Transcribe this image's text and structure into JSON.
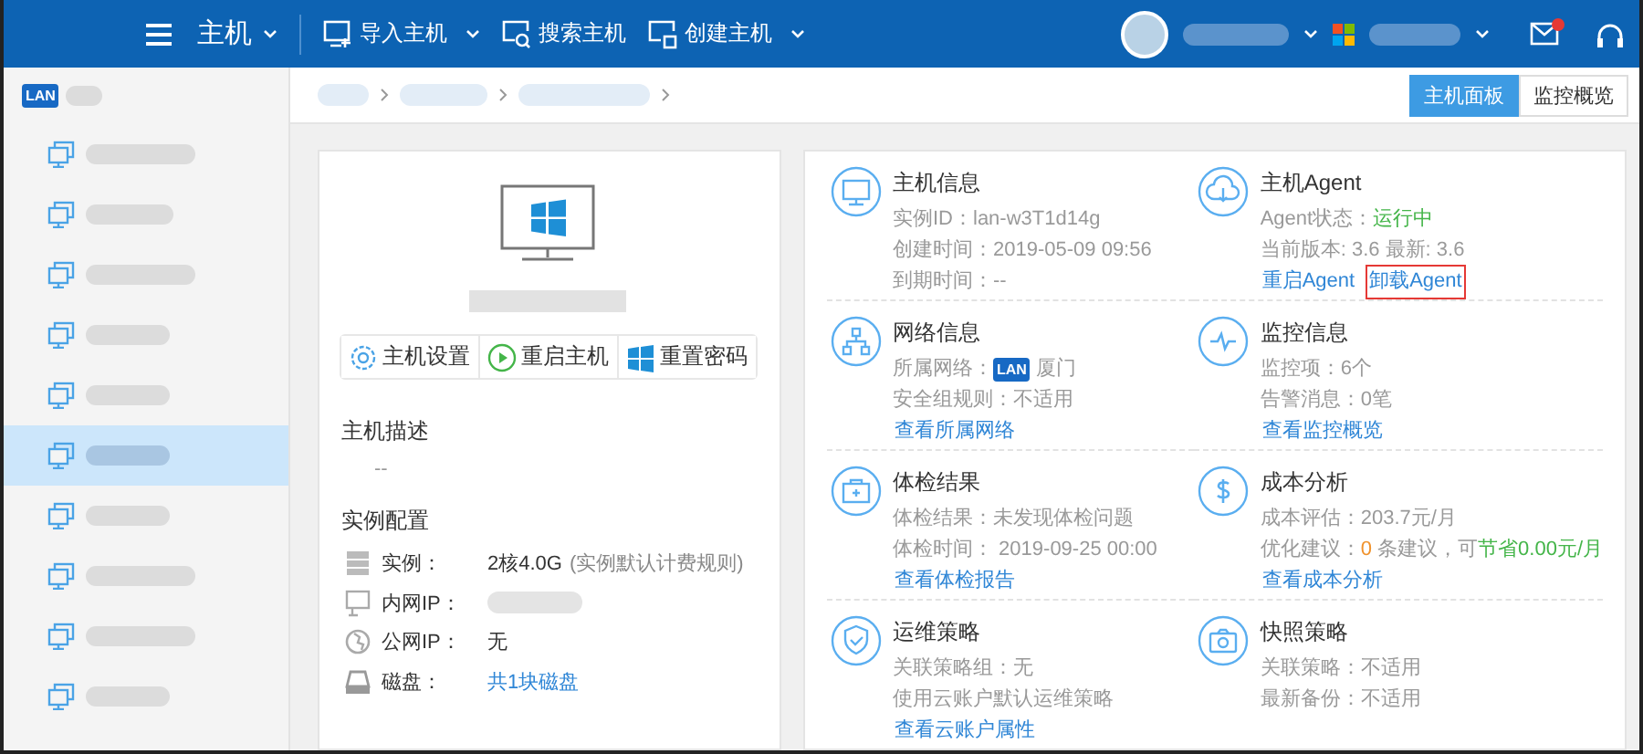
{
  "header": {
    "title": "主机",
    "nav": [
      {
        "kind": "import",
        "label": "导入主机",
        "caret": true
      },
      {
        "kind": "search",
        "label": "搜索主机",
        "caret": false
      },
      {
        "kind": "create",
        "label": "创建主机",
        "caret": true
      }
    ]
  },
  "sidebar": {
    "badge": "LAN",
    "items": [
      {
        "selected": false
      },
      {
        "selected": false
      },
      {
        "selected": false
      },
      {
        "selected": false
      },
      {
        "selected": false
      },
      {
        "selected": true
      },
      {
        "selected": false
      },
      {
        "selected": false
      },
      {
        "selected": false
      },
      {
        "selected": false
      }
    ]
  },
  "view_tabs": [
    {
      "label": "主机面板",
      "selected": true
    },
    {
      "label": "监控概览",
      "selected": false
    }
  ],
  "host_card": {
    "actions": [
      {
        "kind": "settings",
        "label": "主机设置"
      },
      {
        "kind": "restart",
        "label": "重启主机"
      },
      {
        "kind": "windows",
        "label": "重置密码"
      }
    ],
    "description_title": "主机描述",
    "description": "--",
    "config_title": "实例配置",
    "config": [
      {
        "kind": "instance",
        "label": "实例：",
        "value": "2核4.0G",
        "note": "(实例默认计费规则)"
      },
      {
        "kind": "lan",
        "label": "内网IP："
      },
      {
        "kind": "wan",
        "label": "公网IP：",
        "value": "无"
      },
      {
        "kind": "disk",
        "label": "磁盘：",
        "link": "共1块磁盘"
      }
    ]
  },
  "sections": [
    {
      "kind": "monitor",
      "title": "主机信息",
      "lines": [
        [
          {
            "text": "实例ID：lan-w3T1d14g"
          }
        ],
        [
          {
            "text": "创建时间：2019-05-09 09:56"
          }
        ],
        [
          {
            "text": "到期时间：--"
          }
        ]
      ]
    },
    {
      "kind": "cloud",
      "title": "主机Agent",
      "lines": [
        [
          {
            "text": "Agent状态："
          },
          {
            "text": "运行中",
            "color": "#44b549"
          }
        ],
        [
          {
            "text": "当前版本: 3.6 最新: 3.6"
          }
        ]
      ],
      "links": [
        {
          "label": "重启Agent",
          "highlighted": false
        },
        {
          "label": "卸载Agent",
          "highlighted": true
        }
      ]
    },
    {
      "kind": "network",
      "title": "网络信息",
      "lines": [
        [
          {
            "text": "所属网络："
          },
          {
            "badge": "LAN"
          },
          {
            "text": "厦门"
          }
        ],
        [
          {
            "text": "安全组规则：不适用"
          }
        ]
      ],
      "links": [
        {
          "label": "查看所属网络",
          "highlighted": false
        }
      ]
    },
    {
      "kind": "pulse",
      "title": "监控信息",
      "lines": [
        [
          {
            "text": "监控项：6个"
          }
        ],
        [
          {
            "text": "告警消息：0笔"
          }
        ]
      ],
      "links": [
        {
          "label": "查看监控概览",
          "highlighted": false
        }
      ]
    },
    {
      "kind": "health",
      "title": "体检结果",
      "lines": [
        [
          {
            "text": "体检结果：未发现体检问题"
          }
        ],
        [
          {
            "text": "体检时间： 2019-09-25 00:00"
          }
        ]
      ],
      "links": [
        {
          "label": "查看体检报告",
          "highlighted": false
        }
      ]
    },
    {
      "kind": "cost",
      "title": "成本分析",
      "lines": [
        [
          {
            "text": "成本评估：203.7元/月"
          }
        ],
        [
          {
            "text": "优化建议："
          },
          {
            "text": "0",
            "color": "#f0922c"
          },
          {
            "text": " 条建议，可"
          },
          {
            "text": "节省0.00元/月",
            "color": "#44b549"
          }
        ]
      ],
      "links": [
        {
          "label": "查看成本分析",
          "highlighted": false
        }
      ]
    },
    {
      "kind": "shield",
      "title": "运维策略",
      "lines": [
        [
          {
            "text": "关联策略组：无"
          }
        ],
        [
          {
            "text": "使用云账户默认运维策略"
          }
        ]
      ],
      "links": [
        {
          "label": "查看云账户属性",
          "highlighted": false
        }
      ]
    },
    {
      "kind": "camera",
      "title": "快照策略",
      "lines": [
        [
          {
            "text": "关联策略：不适用"
          }
        ],
        [
          {
            "text": "最新备份：不适用"
          }
        ]
      ]
    }
  ]
}
